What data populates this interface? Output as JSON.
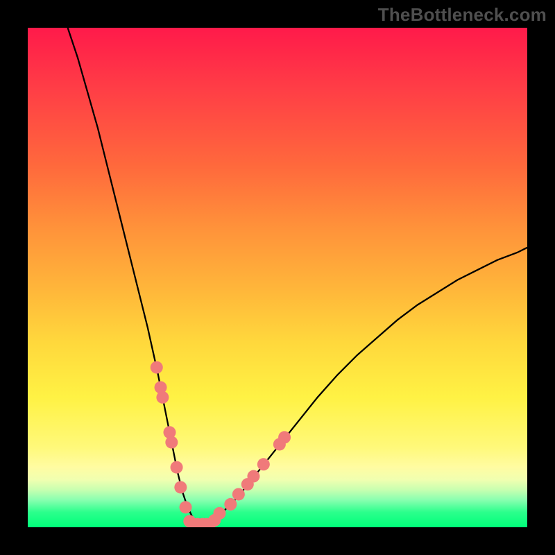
{
  "watermark": "TheBottleneck.com",
  "chart_data": {
    "type": "line",
    "title": "",
    "xlabel": "",
    "ylabel": "",
    "xlim": [
      0,
      100
    ],
    "ylim": [
      0,
      100
    ],
    "grid": false,
    "legend": false,
    "series": [
      {
        "name": "curve",
        "stroke": "#000000",
        "x": [
          8,
          10,
          12,
          14,
          16,
          18,
          20,
          22,
          24,
          26,
          27,
          28,
          29,
          30,
          31,
          32,
          33,
          34,
          35,
          36,
          38,
          42,
          46,
          50,
          54,
          58,
          62,
          66,
          70,
          74,
          78,
          82,
          86,
          90,
          94,
          98,
          100
        ],
        "y": [
          100,
          94,
          87,
          80,
          72,
          64,
          56,
          48,
          40,
          31,
          26,
          21,
          16,
          11,
          7,
          4,
          2,
          0.6,
          0.6,
          0.6,
          2,
          6,
          11,
          16,
          21,
          26,
          30.5,
          34.5,
          38,
          41.5,
          44.5,
          47,
          49.5,
          51.5,
          53.5,
          55,
          56
        ]
      }
    ],
    "markers": {
      "color": "#f07a7a",
      "radius_px": 9,
      "points_xy": [
        [
          25.8,
          32
        ],
        [
          26.6,
          28
        ],
        [
          27.0,
          26
        ],
        [
          28.4,
          19
        ],
        [
          28.8,
          17
        ],
        [
          29.8,
          12
        ],
        [
          30.6,
          8
        ],
        [
          31.6,
          4
        ],
        [
          32.4,
          1.2
        ],
        [
          33.2,
          0.6
        ],
        [
          34.0,
          0.6
        ],
        [
          35.0,
          0.6
        ],
        [
          35.8,
          0.6
        ],
        [
          36.4,
          0.6
        ],
        [
          37.4,
          1.4
        ],
        [
          38.4,
          2.8
        ],
        [
          40.6,
          4.6
        ],
        [
          42.2,
          6.6
        ],
        [
          44.0,
          8.6
        ],
        [
          45.2,
          10.2
        ],
        [
          47.2,
          12.6
        ],
        [
          50.4,
          16.6
        ],
        [
          51.4,
          18
        ]
      ]
    },
    "background_gradient": {
      "direction": "vertical",
      "stops": [
        {
          "pos": 0.0,
          "color": "#ff1a4a"
        },
        {
          "pos": 0.28,
          "color": "#ff6a3c"
        },
        {
          "pos": 0.52,
          "color": "#ffb53a"
        },
        {
          "pos": 0.74,
          "color": "#fff244"
        },
        {
          "pos": 0.9,
          "color": "#f0ffb0"
        },
        {
          "pos": 1.0,
          "color": "#00ff7a"
        }
      ]
    }
  }
}
